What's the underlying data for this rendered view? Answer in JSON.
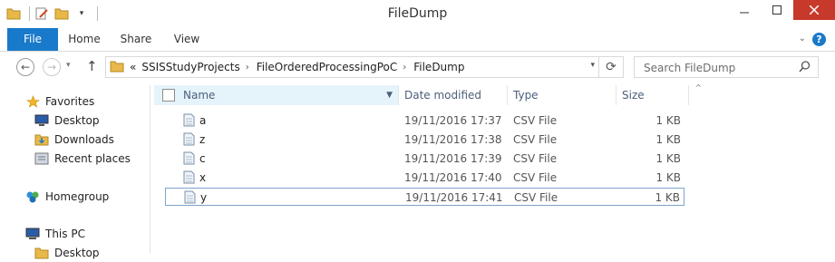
{
  "window": {
    "title": "FileDump"
  },
  "ribbon": {
    "tabs": [
      "File",
      "Home",
      "Share",
      "View"
    ]
  },
  "address": {
    "overflow": "«",
    "crumbs": [
      "SSISStudyProjects",
      "FileOrderedProcessingPoC",
      "FileDump"
    ]
  },
  "search": {
    "placeholder": "Search FileDump"
  },
  "nav": {
    "favorites": "Favorites",
    "desktop": "Desktop",
    "downloads": "Downloads",
    "recent_places": "Recent places",
    "homegroup": "Homegroup",
    "this_pc": "This PC",
    "desktop2": "Desktop"
  },
  "columns": {
    "name": "Name",
    "date": "Date modified",
    "type": "Type",
    "size": "Size"
  },
  "files": [
    {
      "name": "a",
      "date": "19/11/2016 17:37",
      "type": "CSV File",
      "size": "1 KB"
    },
    {
      "name": "z",
      "date": "19/11/2016 17:38",
      "type": "CSV File",
      "size": "1 KB"
    },
    {
      "name": "c",
      "date": "19/11/2016 17:39",
      "type": "CSV File",
      "size": "1 KB"
    },
    {
      "name": "x",
      "date": "19/11/2016 17:40",
      "type": "CSV File",
      "size": "1 KB"
    },
    {
      "name": "y",
      "date": "19/11/2016 17:41",
      "type": "CSV File",
      "size": "1 KB"
    }
  ],
  "selected_file": "y",
  "colors": {
    "accent": "#1979ca",
    "close": "#c7392b",
    "header_text": "#4c607a",
    "selection_border": "#7da2ce"
  }
}
